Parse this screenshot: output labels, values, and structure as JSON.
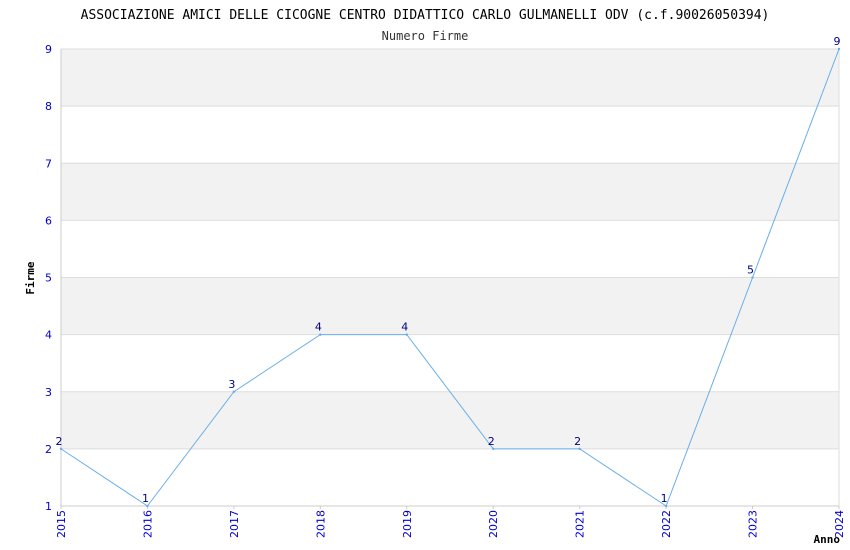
{
  "chart_data": {
    "type": "line",
    "title": "ASSOCIAZIONE AMICI DELLE CICOGNE CENTRO DIDATTICO CARLO GULMANELLI ODV (c.f.90026050394)",
    "subtitle": "Numero Firme",
    "xlabel": "Anno",
    "ylabel": "Firme",
    "categories": [
      "2015",
      "2016",
      "2017",
      "2018",
      "2019",
      "2020",
      "2021",
      "2022",
      "2023",
      "2024"
    ],
    "series": [
      {
        "values": [
          2,
          1,
          3,
          4,
          4,
          2,
          2,
          1,
          5,
          9
        ]
      }
    ],
    "ylim": [
      1,
      9
    ],
    "yticks": [
      "1",
      "2",
      "3",
      "4",
      "5",
      "6",
      "7",
      "8",
      "9"
    ],
    "grid": true,
    "line_color": "#6aaee8",
    "band_color": "#f2f2f2",
    "tick_color": "#0000cc",
    "label_color": "#000080"
  }
}
